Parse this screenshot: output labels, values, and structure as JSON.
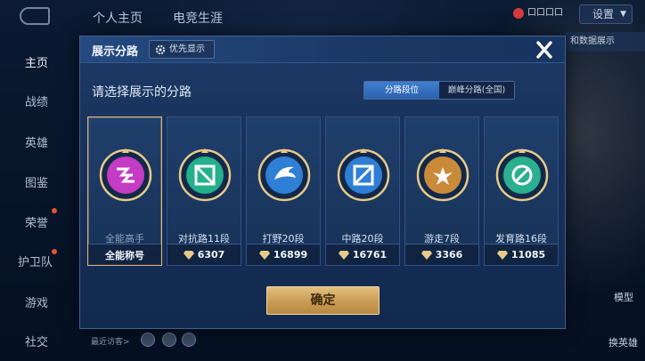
{
  "topbar": {
    "tabs": [
      "个人主页",
      "电竞生涯"
    ],
    "badge_text": "口口口口",
    "settings_label": "设置",
    "compare_label": "和数据展示"
  },
  "sidenav": {
    "items": [
      "主页",
      "战绩",
      "英雄",
      "图鉴",
      "荣誉",
      "护卫队",
      "游戏",
      "社交"
    ],
    "active": "主页"
  },
  "bottom": {
    "recent_label": "最近访客>",
    "model_label": "模型",
    "change_hero_label": "换英雄"
  },
  "modal": {
    "title": "展示分路",
    "priority_label": "优先显示",
    "prompt": "请选择展示的分路",
    "segments": [
      {
        "label": "分路段位",
        "active": true
      },
      {
        "label": "巅峰分路(全国)",
        "active": false
      }
    ],
    "cards": [
      {
        "label": "全能高手",
        "foot": "全能称号",
        "icon": "all-round-emblem-icon",
        "color": "#c43bc4",
        "selected": true,
        "has_diamond": false
      },
      {
        "label": "对抗路11段",
        "foot": "6307",
        "icon": "clash-lane-emblem-icon",
        "color": "#23b08a",
        "selected": false,
        "has_diamond": true
      },
      {
        "label": "打野20段",
        "foot": "16899",
        "icon": "jungle-emblem-icon",
        "color": "#2f7fd6",
        "selected": false,
        "has_diamond": true
      },
      {
        "label": "中路20段",
        "foot": "16761",
        "icon": "mid-lane-emblem-icon",
        "color": "#2f7fd6",
        "selected": false,
        "has_diamond": true
      },
      {
        "label": "游走7段",
        "foot": "3366",
        "icon": "roam-emblem-icon",
        "color": "#c98a3a",
        "selected": false,
        "has_diamond": true
      },
      {
        "label": "发育路16段",
        "foot": "11085",
        "icon": "farm-lane-emblem-icon",
        "color": "#2bb08f",
        "selected": false,
        "has_diamond": true
      }
    ],
    "confirm_label": "确定"
  }
}
